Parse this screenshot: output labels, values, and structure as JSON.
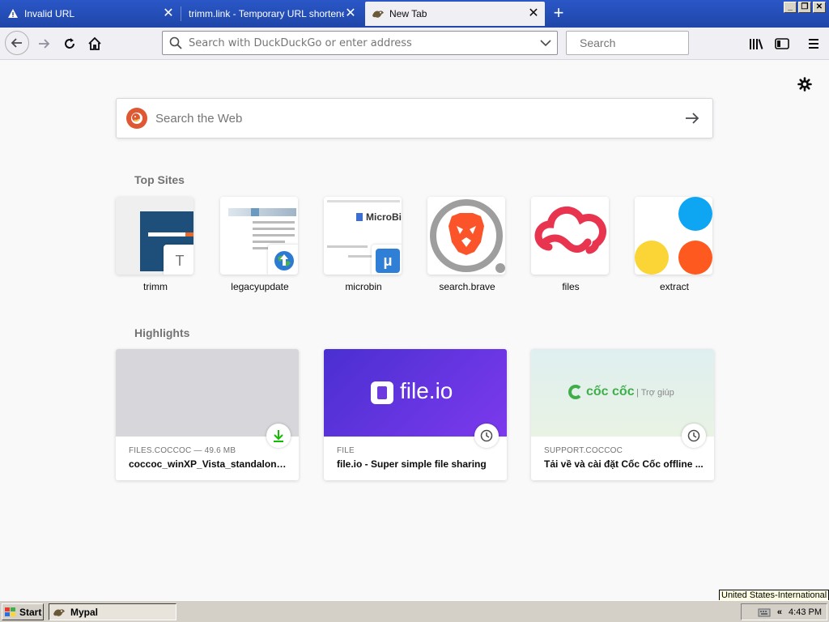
{
  "tabs": [
    {
      "title": "Invalid URL",
      "icon": "warning-icon",
      "selected": false
    },
    {
      "title": "trimm.link - Temporary URL shortener",
      "icon": "none",
      "selected": false
    },
    {
      "title": "New Tab",
      "icon": "mypal-icon",
      "selected": true
    }
  ],
  "new_tab_symbol": "+",
  "window_controls": {
    "minimize": "_",
    "maximize": "❐",
    "close": "✕"
  },
  "urlbar": {
    "placeholder": "Search with DuckDuckGo or enter address"
  },
  "searchbar": {
    "placeholder": "Search"
  },
  "web_search": {
    "placeholder": "Search the Web"
  },
  "top_sites_title": "Top Sites",
  "top_sites": [
    {
      "label": "trimm",
      "badge": "T"
    },
    {
      "label": "legacyupdate",
      "badge": ""
    },
    {
      "label": "microbin",
      "badge": "",
      "preview_text": "MicroBi"
    },
    {
      "label": "search.brave",
      "badge": ""
    },
    {
      "label": "files",
      "badge": ""
    },
    {
      "label": "extract",
      "badge": ""
    }
  ],
  "highlights_title": "Highlights",
  "highlights": [
    {
      "context": "FILES.COCCOC — 49.6 MB",
      "title": "coccoc_winXP_Vista_standalone_...",
      "badge": "download-icon"
    },
    {
      "context": "FILE",
      "title": "file.io - Super simple file sharing",
      "badge": "clock-icon",
      "thumb_text": "file.io"
    },
    {
      "context": "SUPPORT.COCCOC",
      "title": "Tải về và cài đặt Cốc Cốc offline ...",
      "badge": "clock-icon",
      "thumb_text": "cốc cốc",
      "thumb_sub": "Trợ giúp"
    }
  ],
  "tooltip": "United States-International",
  "taskbar": {
    "start_label": "Start",
    "task_label": "Mypal",
    "clock": "4:43 PM",
    "tray_arrow": "«"
  },
  "colors": {
    "tab_strip": "#2a57c7",
    "fileio_purple": "#5b2fd6",
    "brave_orange": "#fb542b",
    "files_red": "#e8344e",
    "extract_blue": "#0ea5f2",
    "extract_yellow": "#fbd435",
    "extract_orange": "#fe5a1f",
    "coccoc_green": "#3fae49"
  }
}
